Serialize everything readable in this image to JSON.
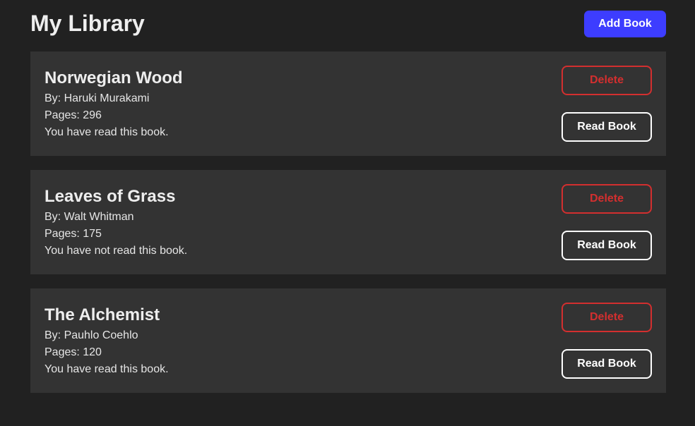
{
  "header": {
    "title": "My Library",
    "add_label": "Add Book"
  },
  "books": [
    {
      "title": "Norwegian Wood",
      "author": "By: Haruki Murakami",
      "pages": "Pages: 296",
      "status": "You have read this book.",
      "delete_label": "Delete",
      "read_label": "Read Book"
    },
    {
      "title": "Leaves of Grass",
      "author": "By: Walt Whitman",
      "pages": "Pages: 175",
      "status": "You have not read this book.",
      "delete_label": "Delete",
      "read_label": "Read Book"
    },
    {
      "title": "The Alchemist",
      "author": "By: Pauhlo Coehlo",
      "pages": "Pages: 120",
      "status": "You have read this book.",
      "delete_label": "Delete",
      "read_label": "Read Book"
    }
  ],
  "colors": {
    "background": "#212121",
    "card": "#333333",
    "accent": "#3d3dff",
    "danger": "#d32f2f"
  }
}
